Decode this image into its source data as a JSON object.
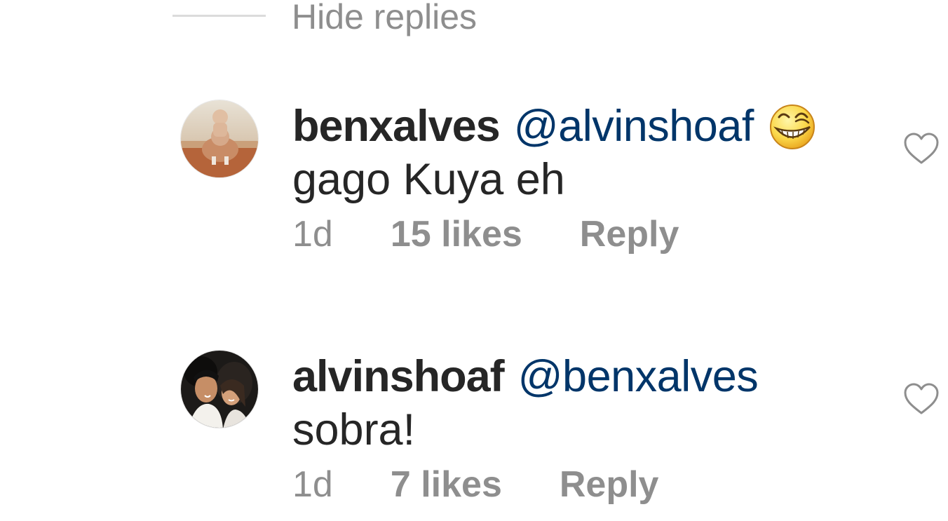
{
  "thread": {
    "hide_replies_label": "Hide replies"
  },
  "comments": [
    {
      "username": "benxalves",
      "mention": "@alvinshoaf",
      "emoji_icon": "grinning-squinting-face-emoji",
      "text": "gago Kuya eh",
      "time": "1d",
      "likes": "15 likes",
      "reply_label": "Reply",
      "like_icon": "heart-outline-icon"
    },
    {
      "username": "alvinshoaf",
      "mention": "@benxalves",
      "text": "sobra!",
      "time": "1d",
      "likes": "7 likes",
      "reply_label": "Reply",
      "like_icon": "heart-outline-icon"
    }
  ],
  "colors": {
    "mention": "#003569",
    "secondary_text": "#8e8e8e",
    "primary_text": "#262626",
    "divider": "#dbdbdb"
  }
}
